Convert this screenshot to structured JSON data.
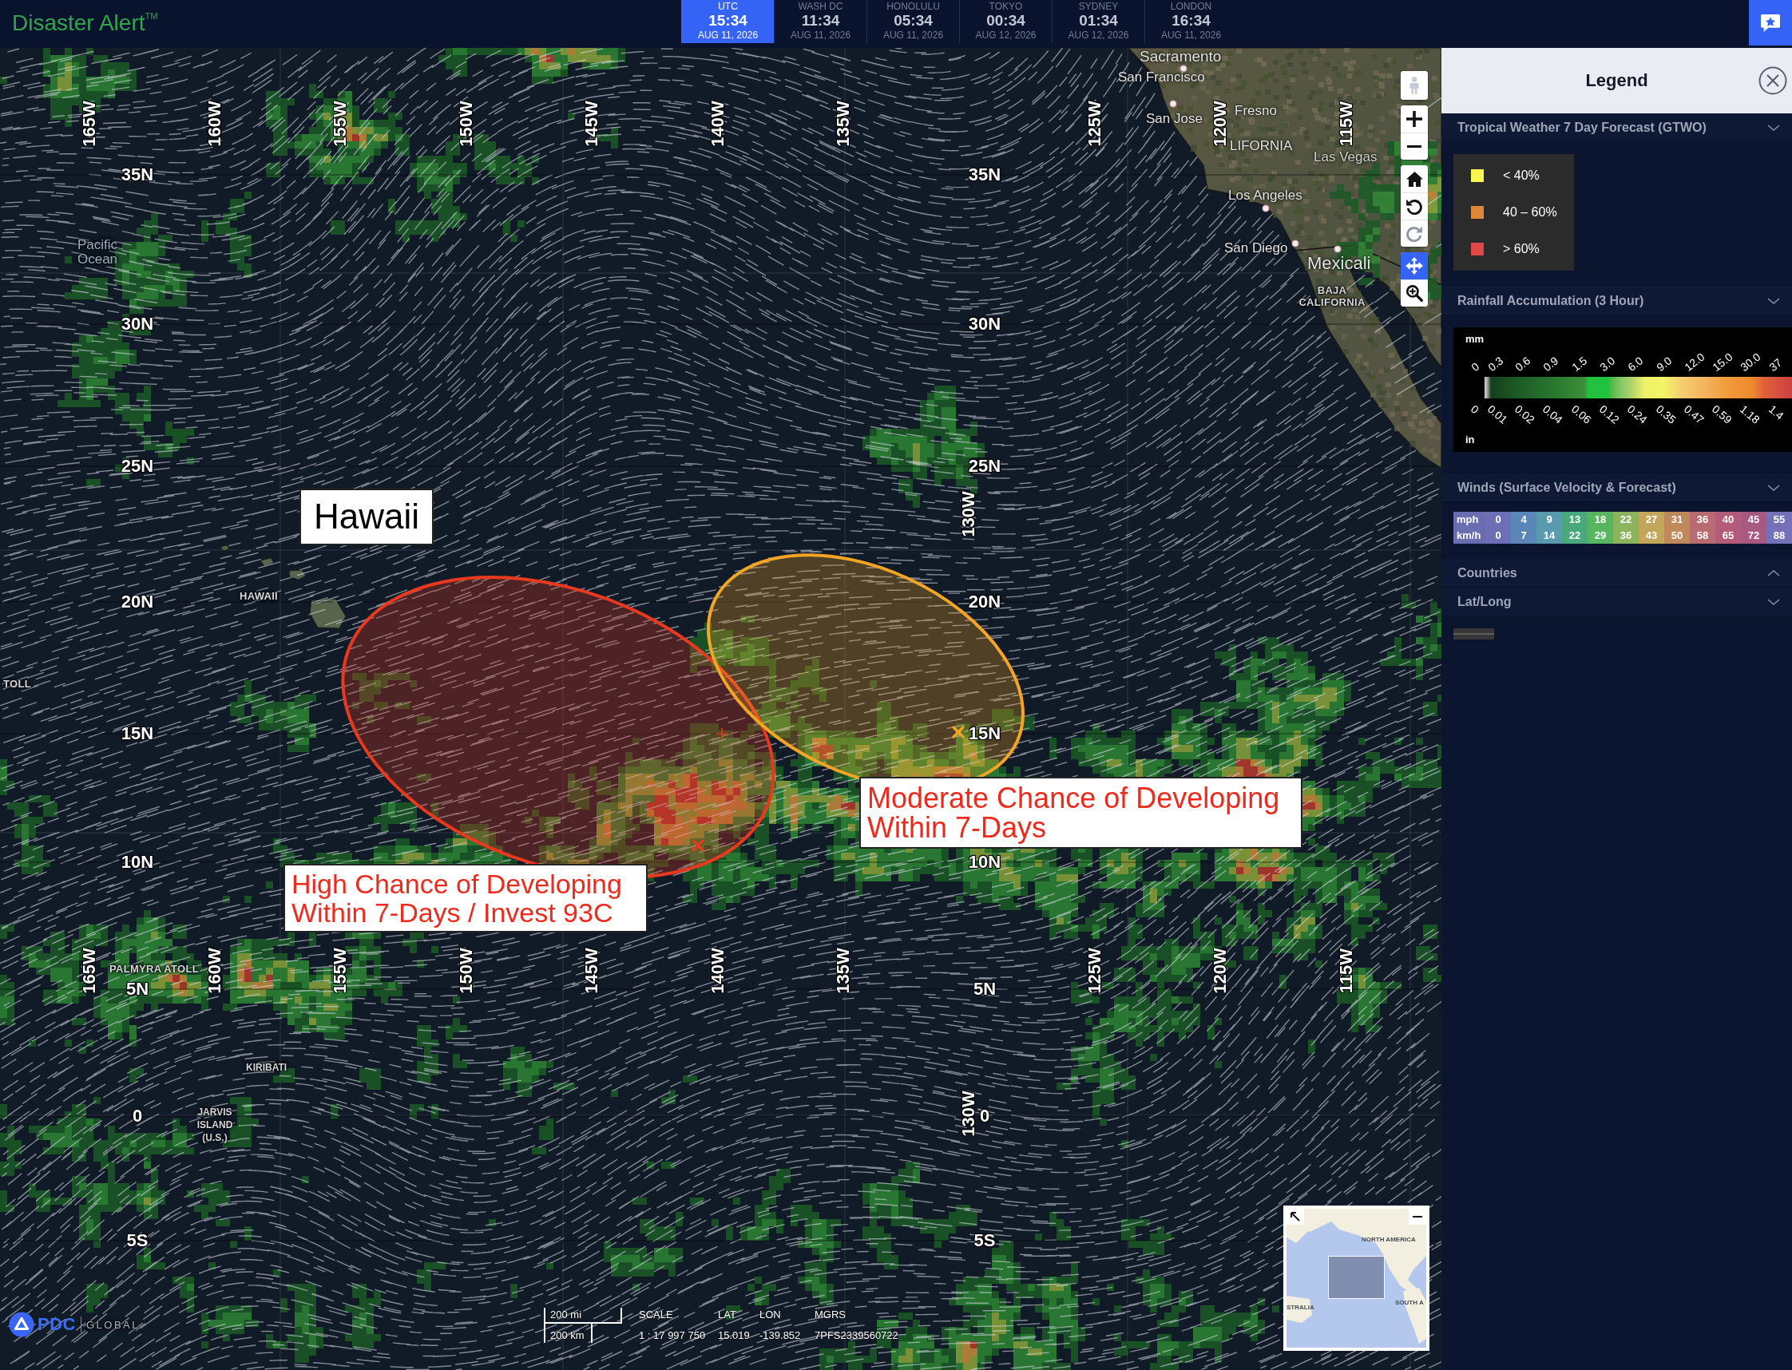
{
  "top_bar": {
    "title": "Disaster Alert$^{TM}$",
    "clocks": [
      {
        "city": "UTC",
        "time": "15:34",
        "date": "AUG 11, 2026",
        "selected": true
      },
      {
        "city": "WASH DC",
        "time": "11:34",
        "date": "AUG 11, 2026",
        "selected": false
      },
      {
        "city": "HONOLULU",
        "time": "05:34",
        "date": "AUG 11, 2026",
        "selected": false
      },
      {
        "city": "TOKYO",
        "time": "00:34",
        "date": "AUG 12, 2026",
        "selected": false
      },
      {
        "city": "SYDNEY",
        "time": "01:34",
        "date": "AUG 12, 2026",
        "selected": false
      },
      {
        "city": "LONDON",
        "time": "16:34",
        "date": "AUG 11, 2026",
        "selected": false
      }
    ]
  },
  "map": {
    "longitude_labels": {
      "top_row": [
        "165W",
        "160W",
        "155W",
        "150W",
        "145W",
        "140W",
        "135W",
        "125W",
        "120W",
        "115W"
      ],
      "center_column": [
        "130W",
        "130W"
      ],
      "bottom_row": [
        "165W",
        "160W",
        "155W",
        "150W",
        "145W",
        "140W",
        "135W",
        "125W",
        "120W",
        "115W"
      ]
    },
    "latitude_labels": {
      "left_column": [
        "35N",
        "30N",
        "25N",
        "20N",
        "15N",
        "10N",
        "5N",
        "0",
        "5S"
      ],
      "center_column": [
        "35N",
        "30N",
        "25N",
        "20N",
        "15N",
        "10N",
        "5N",
        "0",
        "5S"
      ]
    },
    "place_labels": [
      {
        "text": "Sacramento",
        "marker": true
      },
      {
        "text": "San Francisco",
        "marker": false
      },
      {
        "text": "San Jose",
        "marker": true
      },
      {
        "text": "Fresno",
        "marker": false
      },
      {
        "text": "LIFORNIA",
        "marker": false
      },
      {
        "text": "Las Vegas",
        "marker": false
      },
      {
        "text": "Los Angeles",
        "marker": true
      },
      {
        "text": "San Diego",
        "marker": true
      },
      {
        "text": "Mexicali",
        "marker": true
      },
      {
        "text": "BAJA\nCALIFORNIA",
        "marker": false
      },
      {
        "text": "Pacific\nOcean",
        "marker": false
      },
      {
        "text": "HAWAII",
        "marker": false
      },
      {
        "text": "TOLL",
        "marker": false
      },
      {
        "text": "PALMYRA ATOLL",
        "marker": false
      },
      {
        "text": "KIRIBATI",
        "marker": false
      },
      {
        "text": "JARVIS\nISLAND\n(U.S.)",
        "marker": false
      }
    ],
    "forecast_areas": [
      {
        "color": "#e8391f"
      },
      {
        "color": "#f5a524"
      }
    ],
    "annotations": [
      {
        "text": "Hawaii",
        "color": "#000000"
      },
      {
        "text": "High Chance of Developing\nWithin 7-Days / Invest 93C",
        "color": "#ee2a1c"
      },
      {
        "text": "Moderate Chance of Developing\nWithin 7-Days",
        "color": "#ee2a1c"
      }
    ],
    "toolbar": {
      "groups": [
        {
          "buttons": [
            {
              "kind": "street_view",
              "selected": false,
              "disabled": false
            }
          ]
        },
        {
          "buttons": [
            {
              "kind": "zoom_in",
              "selected": false,
              "disabled": false
            },
            {
              "kind": "zoom_out",
              "selected": false,
              "disabled": false
            }
          ]
        },
        {
          "buttons": [
            {
              "kind": "home",
              "selected": false,
              "disabled": false
            },
            {
              "kind": "rotate_left",
              "selected": false,
              "disabled": false
            },
            {
              "kind": "rotate_right",
              "selected": false,
              "disabled": true
            }
          ]
        },
        {
          "buttons": [
            {
              "kind": "pan",
              "selected": true,
              "disabled": false
            },
            {
              "kind": "zoom_box",
              "selected": false,
              "disabled": false
            }
          ]
        }
      ]
    },
    "overview_map": {
      "labels": [
        "NORTH AMERICA",
        "STRALIA",
        "SOUTH A"
      ]
    },
    "logo": {
      "name": "PDC",
      "tagline": "GLOBAL"
    },
    "scale_bar": {
      "imperial": "200 mi",
      "metric": "200 km"
    },
    "readout": [
      {
        "label": "SCALE",
        "value": "1 : 17 997 750"
      },
      {
        "label": "LAT",
        "value": "15.019"
      },
      {
        "label": "LON",
        "value": "-139.852"
      },
      {
        "label": "MGRS",
        "value": "7PFS2339560722"
      }
    ]
  },
  "legend": {
    "title": "Legend",
    "sections": [
      {
        "title": "Tropical Weather 7 Day Forecast (GTWO)",
        "expanded": true,
        "kind": "swatches",
        "items": [
          {
            "label": "< 40%",
            "color": "#f6f650"
          },
          {
            "label": "40 – 60%",
            "color": "#e0883a"
          },
          {
            "label": "> 60%",
            "color": "#e04848"
          }
        ]
      },
      {
        "title": "Rainfall Accumulation (3 Hour)",
        "expanded": true,
        "kind": "gradient",
        "top_unit": "mm",
        "bottom_unit": "in",
        "top_ticks": [
          "0",
          "0.3",
          "0.6",
          "0.9",
          "1.5",
          "3.0",
          "6.0",
          "9.0",
          "12.0",
          "15.0",
          "30.0",
          "37"
        ],
        "bottom_ticks": [
          "0",
          "0.01",
          "0.02",
          "0.04",
          "0.06",
          "0.12",
          "0.24",
          "0.35",
          "0.47",
          "0.59",
          "1.18",
          "1.4"
        ]
      },
      {
        "title": "Winds (Surface Velocity & Forecast)",
        "expanded": true,
        "kind": "wind_scale",
        "row_labels": [
          "mph",
          "km/h"
        ],
        "steps": [
          {
            "mph": "0",
            "kmh": "0",
            "color": "#6b70b4"
          },
          {
            "mph": "4",
            "kmh": "7",
            "color": "#5a87b8"
          },
          {
            "mph": "9",
            "kmh": "14",
            "color": "#5a9aae"
          },
          {
            "mph": "13",
            "kmh": "22",
            "color": "#4aa97c"
          },
          {
            "mph": "18",
            "kmh": "29",
            "color": "#58b65e"
          },
          {
            "mph": "22",
            "kmh": "36",
            "color": "#8cb35d"
          },
          {
            "mph": "27",
            "kmh": "43",
            "color": "#c2a65a"
          },
          {
            "mph": "31",
            "kmh": "50",
            "color": "#c0895c"
          },
          {
            "mph": "36",
            "kmh": "58",
            "color": "#b86c72"
          },
          {
            "mph": "40",
            "kmh": "65",
            "color": "#b35c79"
          },
          {
            "mph": "45",
            "kmh": "72",
            "color": "#a8597f"
          },
          {
            "mph": "55",
            "kmh": "88",
            "color": "#7571b8"
          }
        ]
      },
      {
        "title": "Countries",
        "expanded": false
      },
      {
        "title": "Lat/Long",
        "expanded": true,
        "kind": "line"
      }
    ]
  }
}
